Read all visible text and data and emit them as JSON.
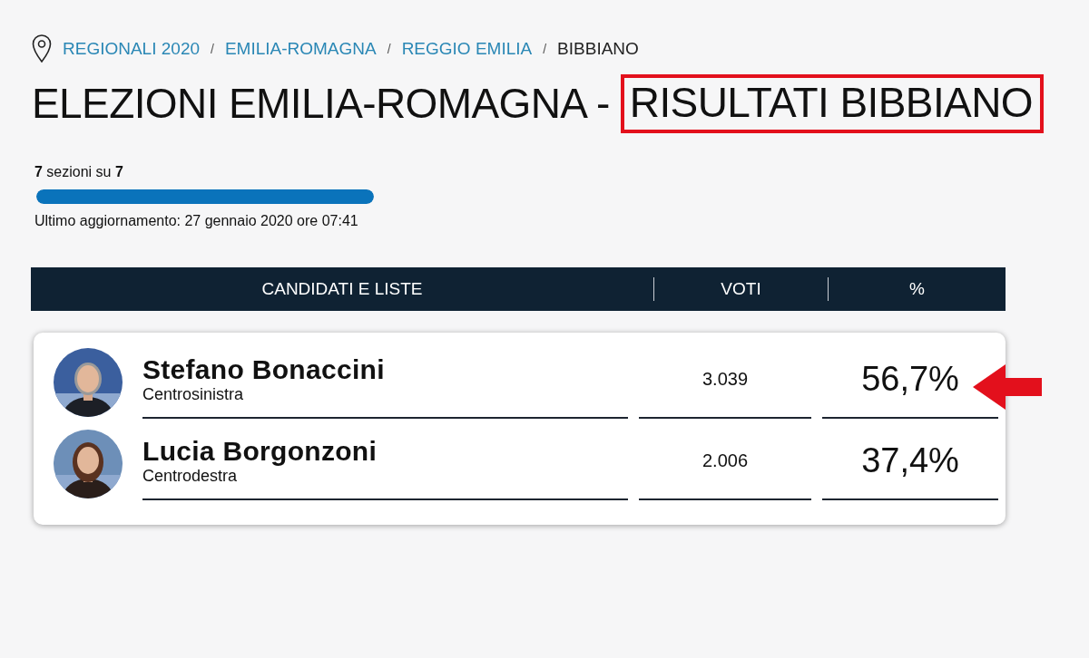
{
  "breadcrumb": [
    {
      "label": "REGIONALI 2020",
      "link": true
    },
    {
      "label": "EMILIA-ROMAGNA",
      "link": true
    },
    {
      "label": "REGGIO EMILIA",
      "link": true
    },
    {
      "label": "BIBBIANO",
      "link": false
    }
  ],
  "breadcrumb_separator": "/",
  "title": {
    "text": "ELEZIONI EMILIA-ROMAGNA -",
    "highlighted": "RISULTATI BIBBIANO"
  },
  "progress": {
    "sections": "**7** sezioni su **7**",
    "level": 1.0,
    "updated": "Ultimo aggiornamento: 27 gennaio 2020 ore 07:41"
  },
  "table": {
    "columns": [
      "CANDIDATI E LISTE",
      "VOTI",
      "%"
    ],
    "rows": [
      {
        "name": "Stefano Bonaccini",
        "coalition": "Centrosinistra",
        "votes": "3.039",
        "percent": "56,7%",
        "pointed": true
      },
      {
        "name": "Lucia Borgonzoni",
        "coalition": "Centrodestra",
        "votes": "2.006",
        "percent": "37,4%",
        "pointed": false
      }
    ]
  }
}
